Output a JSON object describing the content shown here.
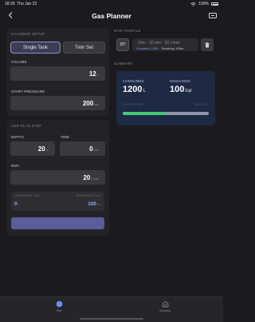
{
  "status_bar": {
    "time": "18:29",
    "date": "Thu Jan 22",
    "battery": "100%"
  },
  "header": {
    "title": "Gas Planner"
  },
  "cylinder_setup": {
    "section_label": "CYLINDER SETUP",
    "options": [
      "Single Tank",
      "Twin Set"
    ],
    "selected": "Single Tank",
    "volume_label": "VOLUME",
    "volume_value": "12",
    "volume_unit": "L",
    "start_pressure_label": "START PRESSURE",
    "start_pressure_value": "200",
    "start_pressure_unit": "bar"
  },
  "add_plan_step": {
    "section_label": "ADD PLAN STEP",
    "depth_label": "DEPTH",
    "depth_value": "20",
    "depth_unit": "m",
    "time_label": "TIME",
    "time_value": "0",
    "time_unit": "min",
    "rmv_label": "RMV",
    "rmv_value": "20",
    "rmv_unit": "L/min",
    "consumed_gas_label": "CONSUMED GAS",
    "consumed_gas_value": "0",
    "consumed_gas_unit": "L",
    "remaining_label": "REMAINING GAS",
    "remaining_value": "100",
    "remaining_unit": "bar",
    "add_button_label": ""
  },
  "dive_profile": {
    "section_label": "DIVE PROFILE",
    "depth_tile": "20°",
    "segment_text": "20m · 20 min · 20 L/min",
    "segment_consumed": "Consumed: 1,200L",
    "segment_remaining": "Remaining: 100bar"
  },
  "summary": {
    "section_label": "SUMMARY",
    "consumed_label": "CONSUMED",
    "consumed_value": "1200",
    "consumed_unit": "L",
    "remaining_label": "REMAINING",
    "remaining_value": "100",
    "remaining_unit": "bar",
    "reserve_text": "20% RESERVE",
    "ratio_text": "50%/2000",
    "gas_used_fraction": 0.5
  },
  "tabs": [
    {
      "label": "Plan",
      "active": true
    },
    {
      "label": "Summary",
      "active": false
    }
  ],
  "colors": {
    "accent": "#8f8fd6",
    "progress": "#44c777",
    "summary_bg": "#1e2a44"
  }
}
